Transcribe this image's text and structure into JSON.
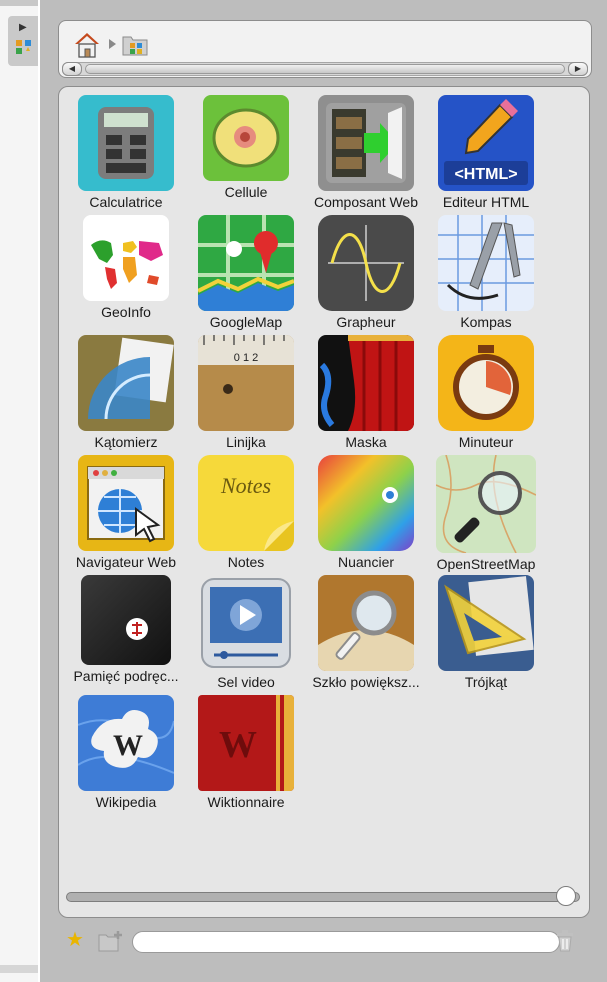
{
  "breadcrumb": [
    {
      "name": "home",
      "icon": "home-icon"
    },
    {
      "name": "applications-folder",
      "icon": "folder-icon"
    }
  ],
  "apps": [
    {
      "label": "Calculatrice",
      "icon": "calculator-icon",
      "color": "#36bccd"
    },
    {
      "label": "Cellule",
      "icon": "cell-icon",
      "color": "#6cc13b"
    },
    {
      "label": "Composant Web",
      "icon": "web-component-icon",
      "color": "#8f8f8f"
    },
    {
      "label": "Editeur HTML",
      "icon": "html-editor-icon",
      "color": "#2553c7",
      "icon_text": "<HTML>"
    },
    {
      "label": "GeoInfo",
      "icon": "world-map-icon",
      "color": "#ffffff"
    },
    {
      "label": "GoogleMap",
      "icon": "map-pin-icon",
      "color": "#2fa843"
    },
    {
      "label": "Grapheur",
      "icon": "sine-graph-icon",
      "color": "#4a4a4a"
    },
    {
      "label": "Kompas",
      "icon": "compass-icon",
      "color": "#e6eefb"
    },
    {
      "label": "Kątomierz",
      "icon": "protractor-icon",
      "color": "#8a7a40"
    },
    {
      "label": "Linijka",
      "icon": "ruler-icon",
      "color": "#b68b4a",
      "icon_text": "0 1 2"
    },
    {
      "label": "Maska",
      "icon": "curtain-icon",
      "color": "#b51010"
    },
    {
      "label": "Minuteur",
      "icon": "stopwatch-icon",
      "color": "#f4b518"
    },
    {
      "label": "Navigateur Web",
      "icon": "browser-globe-icon",
      "color": "#e7b615"
    },
    {
      "label": "Notes",
      "icon": "sticky-note-icon",
      "color": "#f6d93a",
      "icon_text": "Notes"
    },
    {
      "label": "Nuancier",
      "icon": "color-palette-icon",
      "color": "#e8403e"
    },
    {
      "label": "OpenStreetMap",
      "icon": "magnifier-map-icon",
      "color": "#cfe5c0"
    },
    {
      "label": "Pamięć podręc...",
      "icon": "cache-icon",
      "color": "#1c1c1c"
    },
    {
      "label": "Sel video",
      "icon": "video-player-icon",
      "color": "#e6e6e6"
    },
    {
      "label": "Szkło powiększ...",
      "icon": "magnifying-glass-icon",
      "color": "#b0772e"
    },
    {
      "label": "Trójkąt",
      "icon": "triangle-ruler-icon",
      "color": "#3a5d90"
    },
    {
      "label": "Wikipedia",
      "icon": "wikipedia-icon",
      "color": "#3e7cd6",
      "icon_text": "W"
    },
    {
      "label": "Wiktionnaire",
      "icon": "wiktionary-icon",
      "color": "#b31818",
      "icon_text": "W"
    }
  ],
  "zoom": {
    "value": 1.0
  },
  "bottom": {
    "name_value": "",
    "name_placeholder": ""
  }
}
